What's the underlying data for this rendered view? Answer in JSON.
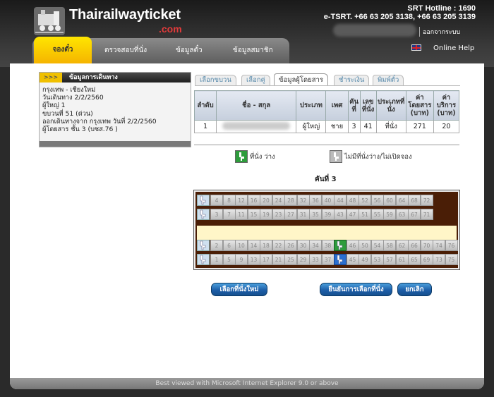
{
  "header": {
    "brand": "Thairailwayticket",
    "brand_sub": ".com",
    "hotline": "SRT Hotline : 1690",
    "contact": "e-TSRT. +66 63 205 3138, +66 63 205 3139",
    "logout": "ออกจากระบบ",
    "online_help": "Online Help"
  },
  "nav": {
    "tabs": [
      "จองตั๋ว",
      "ตรวจสอบที่นั่ง",
      "ข้อมูลตั๋ว",
      "ข้อมูลสมาชิก"
    ]
  },
  "info": {
    "title": "ข้อมูลการเดินทาง",
    "arrows": ">>>",
    "lines": [
      "กรุงเทพ - เชียงใหม่",
      "วันเดินทาง 2/2/2560",
      "ผู้ใหญ่ 1",
      "ขบวนที่ 51 (ด่วน)",
      "ออกเดินทางจาก กรุงเทพ วันที่ 2/2/2560",
      "ผู้โดยสาร ชั้น 3 (บชส.76 )"
    ]
  },
  "steps": [
    "เลือกขบวน",
    "เลือกคู่",
    "ข้อมูลผู้โดยสาร",
    "ชำระเงิน",
    "พิมพ์ตั๋ว"
  ],
  "table": {
    "headers": [
      "ลำดับ",
      "ชื่อ - สกุล",
      "ประเภท",
      "เพศ",
      "คันที่",
      "เลขที่นั่ง",
      "ประเภทที่นั่ง",
      "ค่าโดยสาร (บาท)",
      "ค่าบริการ (บาท)"
    ],
    "rows": [
      [
        "1",
        "",
        "ผู้ใหญ่",
        "ชาย",
        "3",
        "41",
        "ที่นั่ง",
        "271",
        "20"
      ]
    ]
  },
  "legend": {
    "available": "ที่นั่ง ว่าง",
    "unavailable": "ไม่มีที่นั่งว่าง/ไม่เปิดจอง"
  },
  "car_label": "คันที่ 3",
  "seatmap": {
    "row1": [
      "4",
      "8",
      "12",
      "16",
      "20",
      "24",
      "28",
      "32",
      "36",
      "40",
      "44",
      "48",
      "52",
      "56",
      "60",
      "64",
      "68",
      "72"
    ],
    "row2": [
      "3",
      "7",
      "11",
      "15",
      "19",
      "23",
      "27",
      "31",
      "35",
      "39",
      "43",
      "47",
      "51",
      "55",
      "59",
      "63",
      "67",
      "71"
    ],
    "row3": [
      "2",
      "6",
      "10",
      "14",
      "18",
      "22",
      "26",
      "30",
      "34",
      "38",
      "42",
      "46",
      "50",
      "54",
      "58",
      "62",
      "66",
      "70",
      "74",
      "76"
    ],
    "row4": [
      "1",
      "5",
      "9",
      "13",
      "17",
      "21",
      "25",
      "29",
      "33",
      "37",
      "41",
      "45",
      "49",
      "53",
      "57",
      "61",
      "65",
      "69",
      "73",
      "75"
    ],
    "free_seat": "42",
    "selected_seat": "41"
  },
  "buttons": {
    "reselect": "เลือกที่นั่งใหม่",
    "confirm": "ยืนยันการเลือกที่นั่ง",
    "cancel": "ยกเลิก"
  },
  "footer": "Best viewed with Microsoft Internet Explorer 9.0 or above",
  "colors": {
    "accent": "#f5b400",
    "available": "#2e9c3c",
    "selected": "#2a6fd0",
    "button": "#1d5ea8"
  }
}
